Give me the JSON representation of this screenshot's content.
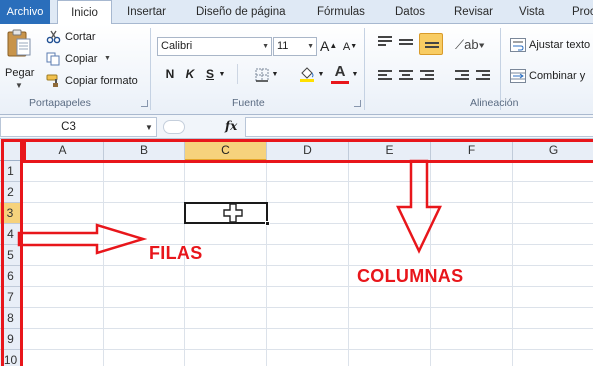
{
  "tabs": {
    "file": "Archivo",
    "home": "Inicio",
    "insert": "Insertar",
    "page_layout": "Diseño de página",
    "formulas": "Fórmulas",
    "data": "Datos",
    "review": "Revisar",
    "view": "Vista",
    "more": "Proc"
  },
  "clipboard": {
    "paste": "Pegar",
    "cut": "Cortar",
    "copy": "Copiar",
    "format_painter": "Copiar formato",
    "group_label": "Portapapeles"
  },
  "font": {
    "family": "Calibri",
    "size": "11",
    "bold": "N",
    "italic": "K",
    "underline": "S",
    "grow": "A",
    "shrink": "A",
    "color_letter": "A",
    "group_label": "Fuente"
  },
  "alignment": {
    "wrap_text": "Ajustar texto",
    "merge_center": "Combinar y",
    "group_label": "Alineación"
  },
  "formula_bar": {
    "name_box": "C3",
    "fx": "fx",
    "value": ""
  },
  "grid": {
    "columns": [
      "A",
      "B",
      "C",
      "D",
      "E",
      "F",
      "G"
    ],
    "rows": [
      "1",
      "2",
      "3",
      "4",
      "5",
      "6",
      "7",
      "8",
      "9",
      "10"
    ],
    "selected_column": "C",
    "selected_row": "3"
  },
  "annotations": {
    "rows_label": "FILAS",
    "columns_label": "COLUMNAS",
    "color": "#e8161b"
  },
  "colors": {
    "accent": "#2a6ebb",
    "selection_header": "#f6d27c"
  }
}
